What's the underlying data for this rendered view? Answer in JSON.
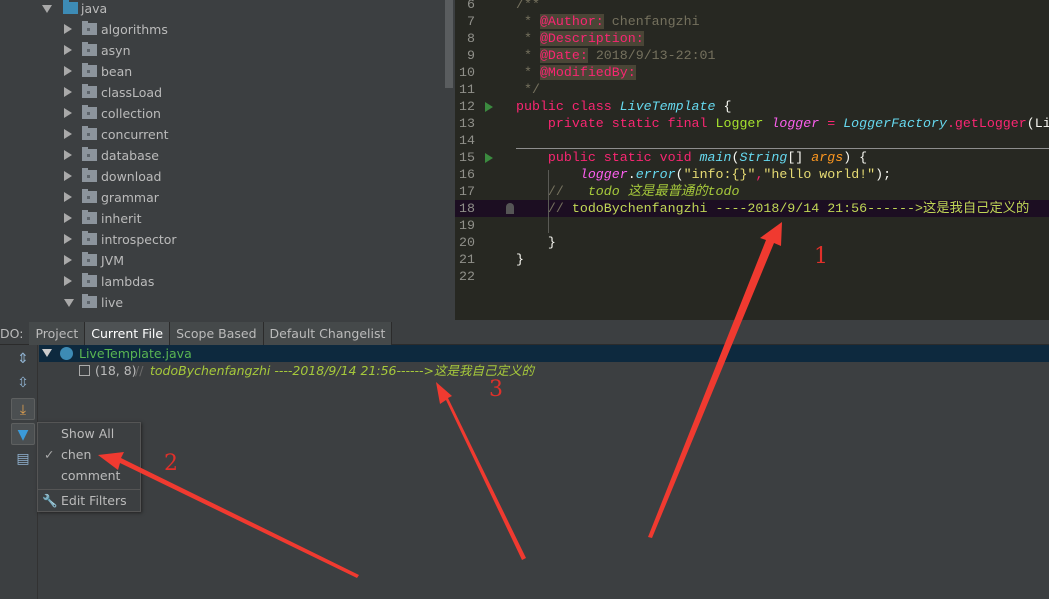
{
  "project_tree": {
    "root": {
      "label": "java",
      "expanded": true
    },
    "items": [
      {
        "label": "algorithms"
      },
      {
        "label": "asyn"
      },
      {
        "label": "bean"
      },
      {
        "label": "classLoad"
      },
      {
        "label": "collection"
      },
      {
        "label": "concurrent"
      },
      {
        "label": "database"
      },
      {
        "label": "download"
      },
      {
        "label": "grammar"
      },
      {
        "label": "inherit"
      },
      {
        "label": "introspector"
      },
      {
        "label": "JVM"
      },
      {
        "label": "lambdas"
      },
      {
        "label": "live",
        "expanded": true
      }
    ]
  },
  "editor": {
    "lines": [
      {
        "n": "6",
        "tokens": [
          {
            "t": "/**",
            "c": "cmt"
          }
        ]
      },
      {
        "n": "7",
        "tokens": [
          {
            "t": " * ",
            "c": "cmt"
          },
          {
            "t": "@Author:",
            "c": "ann"
          },
          {
            "t": " chenfangzhi",
            "c": "annv"
          }
        ]
      },
      {
        "n": "8",
        "tokens": [
          {
            "t": " * ",
            "c": "cmt"
          },
          {
            "t": "@Description:",
            "c": "ann"
          }
        ]
      },
      {
        "n": "9",
        "tokens": [
          {
            "t": " * ",
            "c": "cmt"
          },
          {
            "t": "@Date:",
            "c": "ann"
          },
          {
            "t": " 2018/9/13-22:01",
            "c": "annv"
          }
        ]
      },
      {
        "n": "10",
        "tokens": [
          {
            "t": " * ",
            "c": "cmt"
          },
          {
            "t": "@ModifiedBy:",
            "c": "ann"
          }
        ]
      },
      {
        "n": "11",
        "tokens": [
          {
            "t": " */",
            "c": "cmt"
          }
        ]
      },
      {
        "n": "12",
        "run": true,
        "tokens": [
          {
            "t": "public class ",
            "c": "kw"
          },
          {
            "t": "LiveTemplate",
            "c": "cls"
          },
          {
            "t": " {",
            "c": "pl"
          }
        ]
      },
      {
        "n": "13",
        "tokens": [
          {
            "t": "    private static final ",
            "c": "kw"
          },
          {
            "t": "Logger ",
            "c": "typ"
          },
          {
            "t": "logger",
            "c": "fld"
          },
          {
            "t": " = ",
            "c": "op"
          },
          {
            "t": "LoggerFactory",
            "c": "cls"
          },
          {
            "t": ".getLogger",
            "c": "kw"
          },
          {
            "t": "(Li",
            "c": "pl"
          }
        ]
      },
      {
        "n": "14",
        "tokens": []
      },
      {
        "n": "15",
        "run": true,
        "tokens": [
          {
            "t": "    public static void ",
            "c": "kw"
          },
          {
            "t": "main",
            "c": "cls"
          },
          {
            "t": "(",
            "c": "pl"
          },
          {
            "t": "String",
            "c": "cls"
          },
          {
            "t": "[] ",
            "c": "pl"
          },
          {
            "t": "args",
            "c": "par"
          },
          {
            "t": ") {",
            "c": "pl"
          }
        ]
      },
      {
        "n": "16",
        "tokens": [
          {
            "t": "        ",
            "c": "pl"
          },
          {
            "t": "logger",
            "c": "fld"
          },
          {
            "t": ".",
            "c": "pl"
          },
          {
            "t": "error",
            "c": "cls"
          },
          {
            "t": "(",
            "c": "pl"
          },
          {
            "t": "\"info:{}\"",
            "c": "str"
          },
          {
            "t": ",",
            "c": "kw"
          },
          {
            "t": "\"hello world!\"",
            "c": "str"
          },
          {
            "t": ");",
            "c": "pl"
          }
        ]
      },
      {
        "n": "17",
        "tokens": [
          {
            "t": "    //   ",
            "c": "cmt"
          },
          {
            "t": "todo 这是最普通的todo",
            "c": "todo"
          }
        ]
      },
      {
        "n": "18",
        "highlight": true,
        "tokens": [
          {
            "t": "    // ",
            "c": "cmt"
          },
          {
            "t": "todoBychenfangzhi ----2018/9/14 21:56------>这是我自己定义的",
            "c": "todo2"
          }
        ]
      },
      {
        "n": "19",
        "tokens": []
      },
      {
        "n": "20",
        "tokens": [
          {
            "t": "    }",
            "c": "pl"
          }
        ]
      },
      {
        "n": "21",
        "tokens": [
          {
            "t": "}",
            "c": "pl"
          }
        ]
      },
      {
        "n": "22",
        "tokens": []
      }
    ]
  },
  "todo_panel": {
    "label": "DO:",
    "tabs": [
      {
        "label": "Project"
      },
      {
        "label": "Current File",
        "selected": true
      },
      {
        "label": "Scope Based"
      },
      {
        "label": "Default Changelist"
      }
    ],
    "file": "LiveTemplate.java",
    "item": {
      "position": "(18, 8)",
      "prefix": "//",
      "text": "todoBychenfangzhi ----2018/9/14 21:56------>这是我自己定义的"
    },
    "filter_menu": {
      "items": [
        {
          "label": "Show All",
          "checked": false
        },
        {
          "label": "chen",
          "checked": true
        },
        {
          "label": "comment",
          "checked": false
        }
      ],
      "edit": "Edit Filters"
    }
  },
  "annotations": {
    "one": "1",
    "two": "2",
    "three": "3",
    "color": "#e8372e"
  }
}
